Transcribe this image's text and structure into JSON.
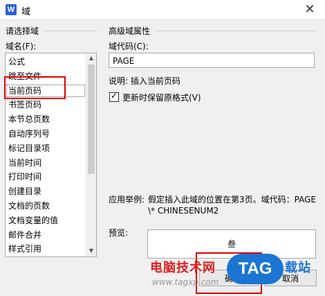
{
  "window": {
    "app_icon": "W",
    "title": "域",
    "close_icon": "close-icon"
  },
  "left_group": {
    "title": "请选择域",
    "field_label": "域名(F):",
    "items": [
      "公式",
      "跳至文件",
      "当前页码",
      "书签页码",
      "本节总页数",
      "自动序列号",
      "标记目录项",
      "当前时间",
      "打印时间",
      "创建目录",
      "文档的页数",
      "文档变量的值",
      "邮件合并",
      "样式引用"
    ],
    "selected_index": 2
  },
  "right_group": {
    "title": "高级域属性",
    "code_label": "域代码(C):",
    "code_value": "PAGE",
    "description": "说明: 插入当前页码",
    "checkbox": {
      "label": "更新时保留原格式(V)",
      "checked": true
    },
    "example_label": "应用举例:",
    "example_line1": "假定插入此域的位置在第3页。域代码：PAGE",
    "example_line2": "\\* CHINESENUM2",
    "preview_label": "预览:",
    "preview_value": "叁"
  },
  "buttons": {
    "ok_partial": "确",
    "cancel": "取消"
  },
  "watermark": {
    "site_text": "电脑技术网",
    "url": "www.tagxp.com",
    "tag_logo": "TAG",
    "suffix": "载站"
  },
  "colors": {
    "highlight_red": "#e00000",
    "tag_blue": "#1a76d2"
  }
}
